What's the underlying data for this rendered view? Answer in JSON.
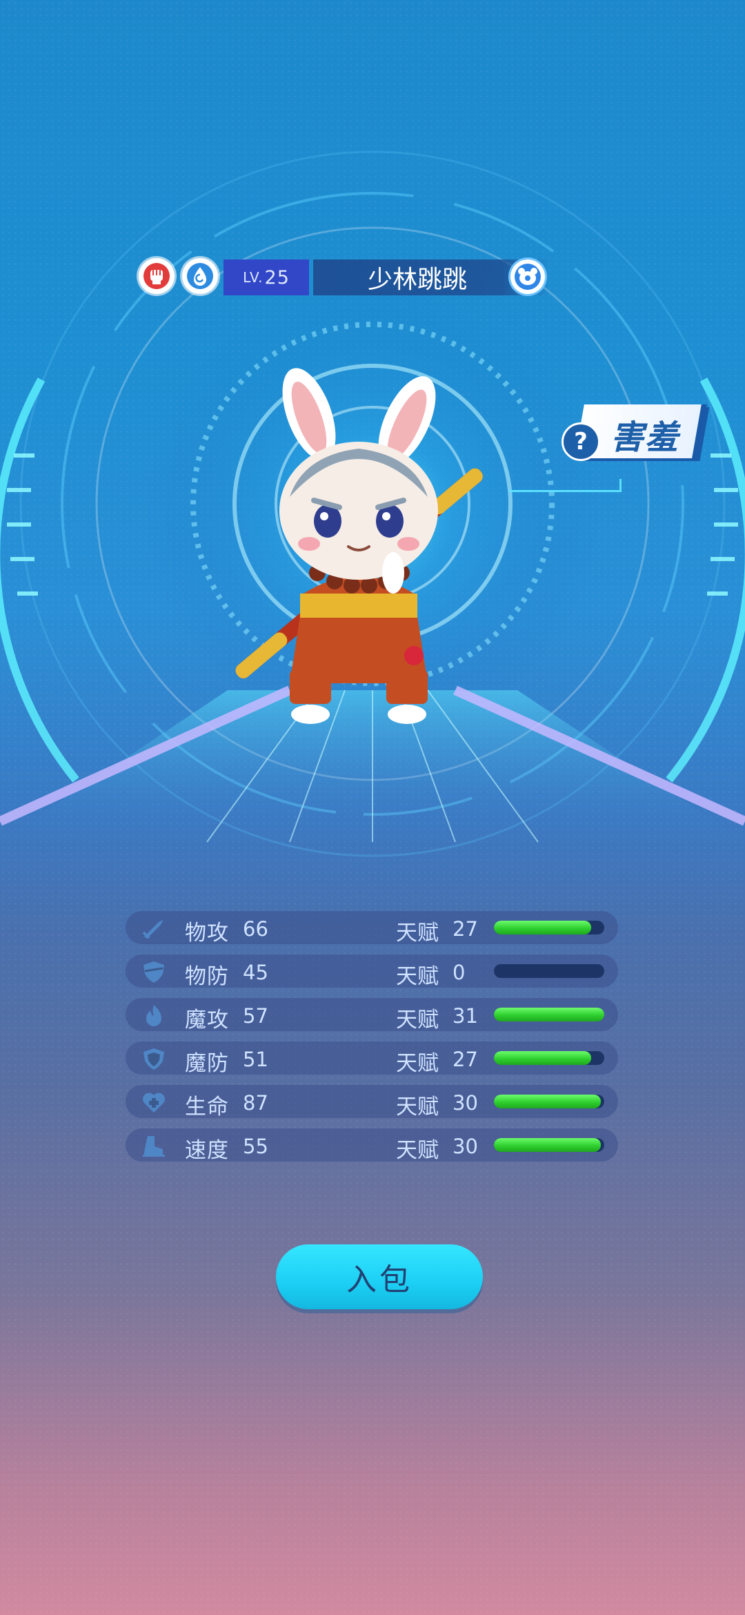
{
  "pet": {
    "level_prefix": "LV.",
    "level": "25",
    "name": "少林跳跳",
    "type_icons": [
      "fist-icon",
      "water-icon"
    ],
    "gender_icon": "bear-face-icon",
    "trait": "害羞",
    "trait_icon": "question-icon"
  },
  "stats": [
    {
      "label": "物攻",
      "value": "66",
      "talent_label": "天赋",
      "talent": "27",
      "fill": 0.88,
      "icon": "sword-icon"
    },
    {
      "label": "物防",
      "value": "45",
      "talent_label": "天赋",
      "talent": "0",
      "fill": 0.0,
      "icon": "shield-icon"
    },
    {
      "label": "魔攻",
      "value": "57",
      "talent_label": "天赋",
      "talent": "31",
      "fill": 1.0,
      "icon": "flame-icon"
    },
    {
      "label": "魔防",
      "value": "51",
      "talent_label": "天赋",
      "talent": "27",
      "fill": 0.88,
      "icon": "magic-shield-icon"
    },
    {
      "label": "生命",
      "value": "87",
      "talent_label": "天赋",
      "talent": "30",
      "fill": 0.97,
      "icon": "heart-plus-icon"
    },
    {
      "label": "速度",
      "value": "55",
      "talent_label": "天赋",
      "talent": "30",
      "fill": 0.97,
      "icon": "boot-icon"
    }
  ],
  "actions": {
    "bag_button": "入包"
  },
  "colors": {
    "bar_fill": "#2fd02f",
    "bar_empty": "#1d3566",
    "button": "#1ccff4",
    "level_box": "#3247c8"
  }
}
